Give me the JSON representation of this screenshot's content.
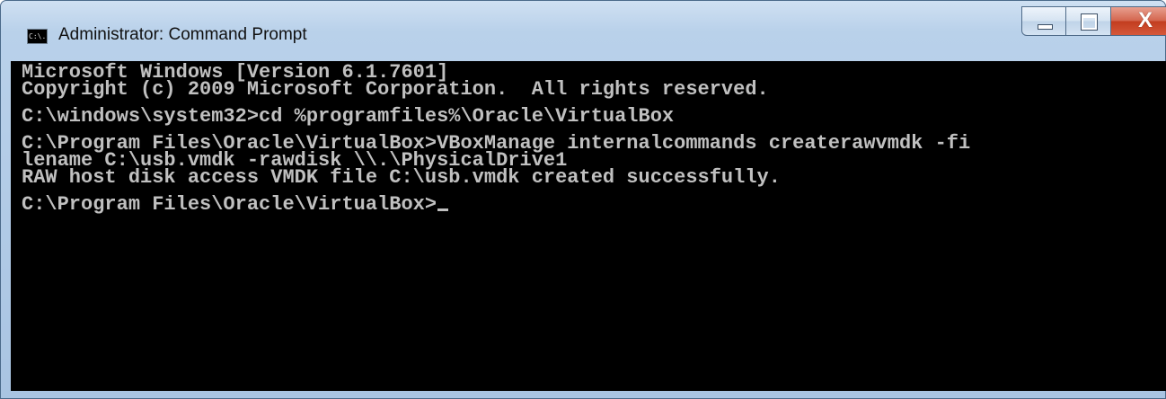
{
  "window": {
    "title": "Administrator: Command Prompt",
    "icon": "cmd-icon",
    "icon_text": "C:\\."
  },
  "caption_buttons": {
    "minimize": "minimize-icon",
    "maximize": "maximize-icon",
    "close": "close-icon",
    "close_glyph": "X"
  },
  "console": {
    "lines": [
      "Microsoft Windows [Version 6.1.7601]",
      "Copyright (c) 2009 Microsoft Corporation.  All rights reserved.",
      "",
      "C:\\windows\\system32>cd %programfiles%\\Oracle\\VirtualBox",
      "",
      "C:\\Program Files\\Oracle\\VirtualBox>VBoxManage internalcommands createrawvmdk -fi",
      "lename C:\\usb.vmdk -rawdisk \\\\.\\PhysicalDrive1",
      "RAW host disk access VMDK file C:\\usb.vmdk created successfully.",
      ""
    ],
    "prompt": "C:\\Program Files\\Oracle\\VirtualBox>"
  },
  "colors": {
    "console_bg": "#000000",
    "console_fg": "#c0c0c0",
    "close_button": "#c23d1f"
  }
}
